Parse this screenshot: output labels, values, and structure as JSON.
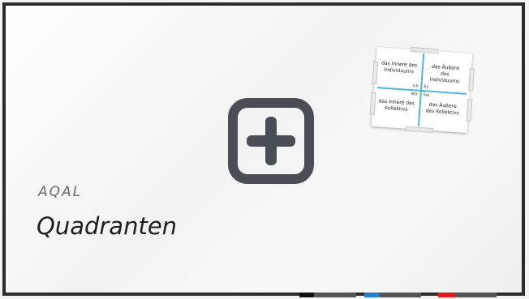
{
  "slide": {
    "subtitle": "AQAL",
    "title": "Quadranten"
  },
  "add_button": {
    "icon": "plus-square-icon",
    "color": "#4a4d53"
  },
  "quadrant_card": {
    "top_left": "das Innere des Individuums",
    "top_right": "das Äußere des Individuums",
    "bottom_left": "das Innere des Kollektivs",
    "bottom_right": "das Äußere des Kollektivs",
    "center_top_left": "Ich",
    "center_top_right": "Es",
    "center_bottom_left": "Wir",
    "center_bottom_right": "Sie",
    "accent": "#4fb7d6"
  },
  "markers": [
    {
      "name": "black",
      "cap": "#111111",
      "body": "#555555"
    },
    {
      "name": "blue",
      "cap": "#1f7fd0",
      "body": "#555555"
    },
    {
      "name": "red",
      "cap": "#e01b1b",
      "body": "#555555"
    }
  ]
}
